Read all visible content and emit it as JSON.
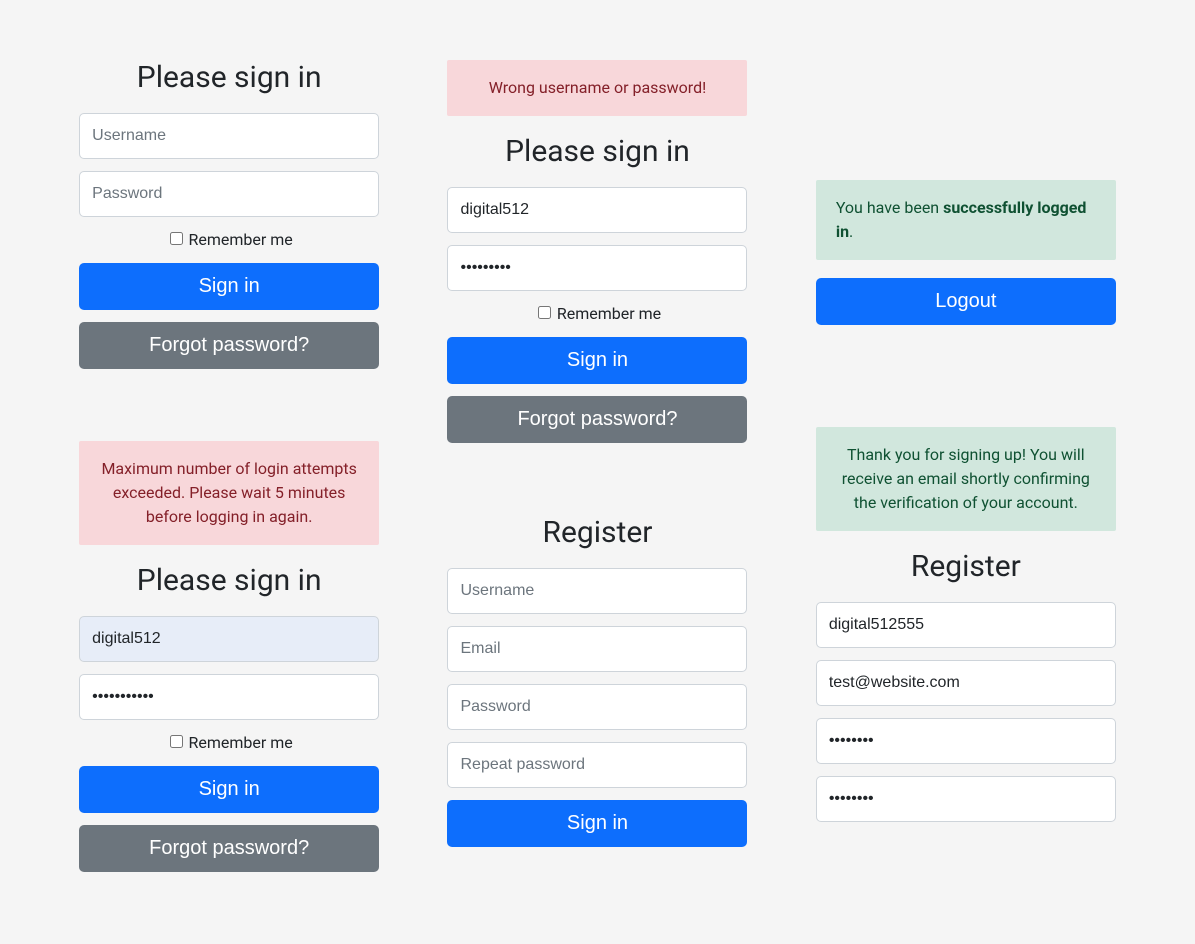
{
  "colors": {
    "primary": "#0d6efd",
    "secondary": "#6c757d",
    "danger_bg": "#f8d7da",
    "danger_fg": "#842029",
    "success_bg": "#d1e7dd",
    "success_fg": "#0f5132"
  },
  "signin1": {
    "heading": "Please sign in",
    "username_placeholder": "Username",
    "password_placeholder": "Password",
    "remember_label": "Remember me",
    "signin_btn": "Sign in",
    "forgot_btn": "Forgot password?"
  },
  "signin2": {
    "alert": "Maximum number of login attempts exceeded. Please wait 5 minutes before logging in again.",
    "heading": "Please sign in",
    "username_value": "digital512",
    "password_value": "•••••••••••",
    "remember_label": "Remember me",
    "signin_btn": "Sign in",
    "forgot_btn": "Forgot password?"
  },
  "signin3": {
    "alert": "Wrong username or password!",
    "heading": "Please sign in",
    "username_value": "digital512",
    "password_value": "•••••••••",
    "remember_label": "Remember me",
    "signin_btn": "Sign in",
    "forgot_btn": "Forgot password?"
  },
  "register1": {
    "heading": "Register",
    "username_placeholder": "Username",
    "email_placeholder": "Email",
    "password_placeholder": "Password",
    "repeat_placeholder": "Repeat password",
    "submit_btn": "Sign in"
  },
  "loggedin": {
    "alert_prefix": "You have been ",
    "alert_bold": "successfully logged in",
    "alert_suffix": ".",
    "logout_btn": "Logout"
  },
  "register2": {
    "alert": "Thank you for signing up! You will receive an email shortly confirming the verification of your account.",
    "heading": "Register",
    "username_value": "digital512555",
    "email_value": "test@website.com",
    "password_value": "••••••••",
    "repeat_value": "••••••••"
  }
}
